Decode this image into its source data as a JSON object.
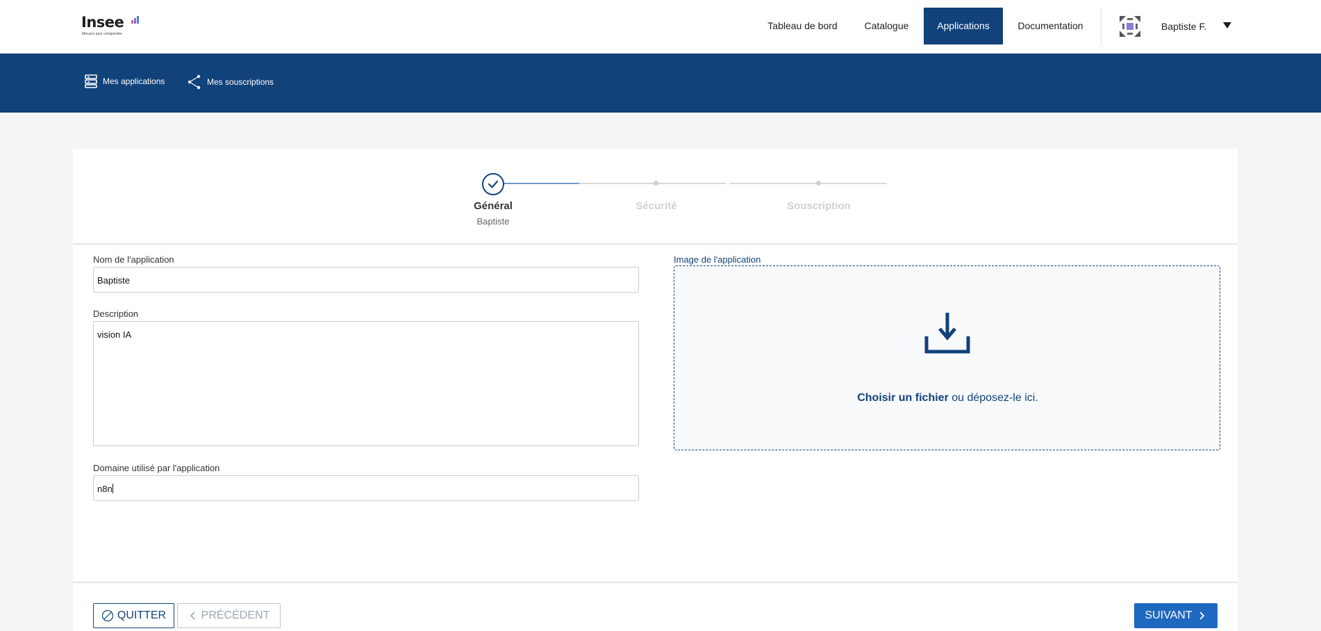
{
  "brand": {
    "name": "Insee",
    "tagline": "Mesurer pour comprendre"
  },
  "header": {
    "nav": [
      {
        "label": "Tableau de bord"
      },
      {
        "label": "Catalogue"
      },
      {
        "label": "Applications",
        "active": true
      },
      {
        "label": "Documentation"
      }
    ],
    "user_name": "Baptiste F."
  },
  "subnav": {
    "items": [
      {
        "label": "Mes applications",
        "icon": "server-stack-icon"
      },
      {
        "label": "Mes souscriptions",
        "icon": "share-icon"
      }
    ]
  },
  "stepper": {
    "steps": [
      {
        "label": "Général",
        "sublabel": "Baptiste",
        "state": "done"
      },
      {
        "label": "Sécurité",
        "sublabel": "",
        "state": "pending"
      },
      {
        "label": "Souscription",
        "sublabel": "",
        "state": "pending"
      }
    ]
  },
  "form": {
    "name_label": "Nom de l'application",
    "name_value": "Baptiste",
    "description_label": "Description",
    "description_value": "vision IA",
    "domain_label": "Domaine utilisé par l'application",
    "domain_value": "n8n",
    "image_label": "Image de l'application",
    "dropzone_action": "Choisir un fichier",
    "dropzone_text": " ou déposez-le ici."
  },
  "footer": {
    "quit_label": "QUITTER",
    "prev_label": "PRÉCÉDENT",
    "next_label": "SUIVANT"
  },
  "colors": {
    "brand_blue": "#11427a",
    "button_blue": "#1f68c0",
    "page_bg": "#f4f5f5"
  }
}
